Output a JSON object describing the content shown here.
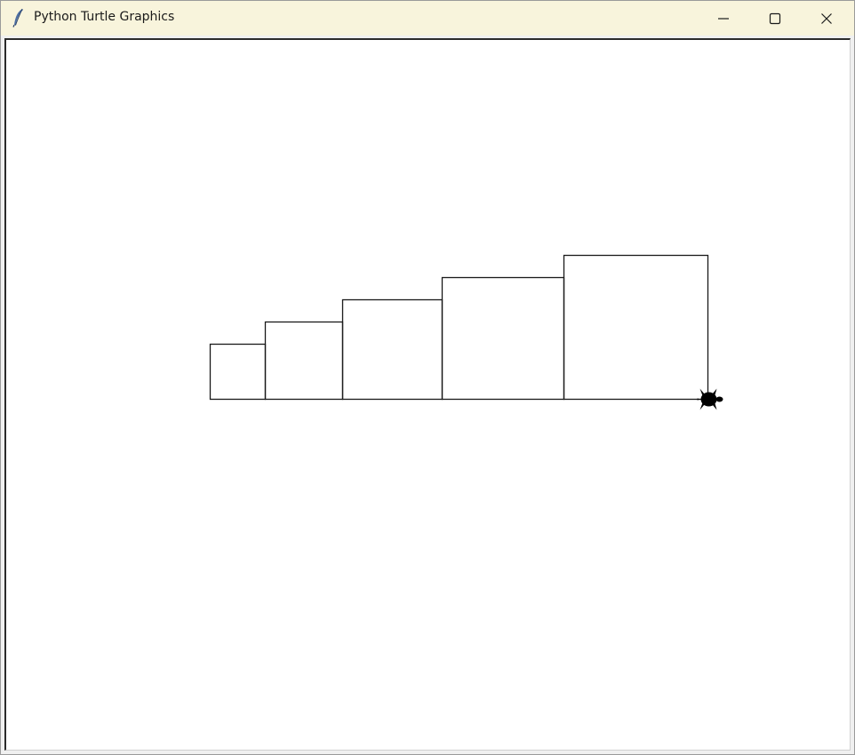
{
  "window": {
    "title": "Python Turtle Graphics",
    "icon": "feather-icon",
    "controls": [
      "minimize-icon",
      "maximize-icon",
      "close-icon"
    ]
  },
  "canvas": {
    "background": "#ffffff",
    "pen_color": "#1a1a1a",
    "turtle": {
      "shape": "turtle",
      "color": "#000000",
      "heading_degrees": 0
    },
    "squares_side_lengths": [
      62,
      87,
      112,
      137,
      162
    ]
  }
}
